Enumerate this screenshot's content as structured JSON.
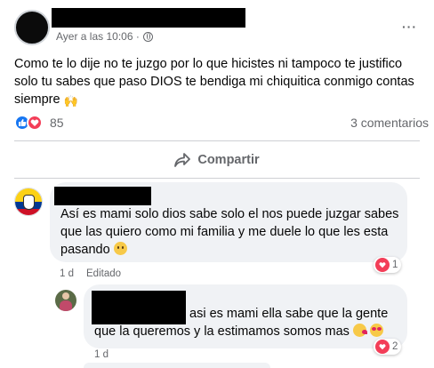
{
  "post": {
    "timestamp": "Ayer a las 10:06 ·",
    "privacy_icon": "globe-icon",
    "more_icon": "more-options-icon",
    "more_label": "···",
    "text": "Como te lo dije no te juzgo por lo que hicistes ni tampoco te justifico solo tu sabes que paso DIOS te bendiga mi chiquitica conmigo contas siempre",
    "text_emoji": "folded-hands-emoji",
    "reactions": {
      "icons": [
        "like-icon",
        "love-icon"
      ],
      "count": "85"
    },
    "comment_count": "3 comentarios"
  },
  "actions": {
    "share_label": "Compartir",
    "share_icon": "share-arrow-icon"
  },
  "comments": [
    {
      "avatar": "colombia-flag-avatar",
      "text": "Así es mami solo dios sabe solo el nos puede juzgar sabes que las quiero como mi familia y me duele lo que les esta pasando",
      "emoji": "sad-face-emoji",
      "time": "1 d",
      "edited": "Editado",
      "reaction_icon": "love-icon",
      "reaction_count": "1"
    },
    {
      "avatar": "user-photo-avatar",
      "text": "asi es mami ella sabe que la gente que la queremos y la estimamos somos mas",
      "emojis": [
        "kiss-face-emoji",
        "heart-eyes-emoji"
      ],
      "time": "1 d",
      "reaction_icon": "love-icon",
      "reaction_count": "2"
    }
  ],
  "colors": {
    "like": "#1877f2",
    "love": "#f33e58",
    "secondary_text": "#65676b",
    "bubble": "#f0f2f5"
  }
}
